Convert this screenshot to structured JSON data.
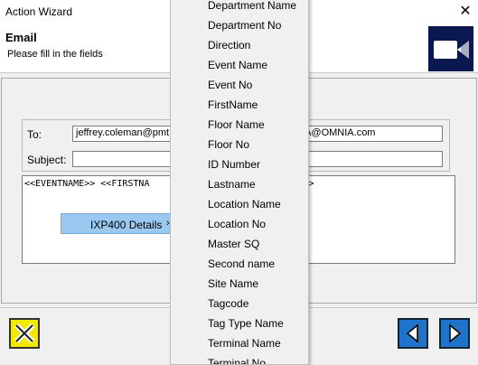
{
  "window": {
    "title": "Action Wizard"
  },
  "header": {
    "title": "Email",
    "subtitle": "Please fill in the fields"
  },
  "form": {
    "to_label": "To:",
    "to_value": "jeffrey.coleman@pmt",
    "to_value_tail": "A@OMNIA.com",
    "subject_label": "Subject:",
    "subject_value": "",
    "message_left": "<<EVENTNAME>>  <<FIRSTNA",
    "message_right": "IME>>"
  },
  "context_menu": {
    "item_label": "IXP400 Details",
    "arrow": "›"
  },
  "submenu": {
    "items": [
      "Department Name",
      "Department No",
      "Direction",
      "Event Name",
      "Event No",
      "FirstName",
      "Floor Name",
      "Floor No",
      "ID Number",
      "Lastname",
      "Location Name",
      "Location No",
      "Master SQ",
      "Second name",
      "Site Name",
      "Tagcode",
      "Tag Type Name",
      "Terminal Name",
      "Terminal No"
    ]
  },
  "colors": {
    "nav_button": "#1f73c8",
    "cancel_button": "#f2e800",
    "header_icon_bg": "#0b1750"
  },
  "icons": {
    "close": "close-icon",
    "header": "video-camera-icon",
    "cancel": "cancel-x-icon",
    "back": "back-arrow-icon",
    "next": "next-arrow-icon"
  }
}
